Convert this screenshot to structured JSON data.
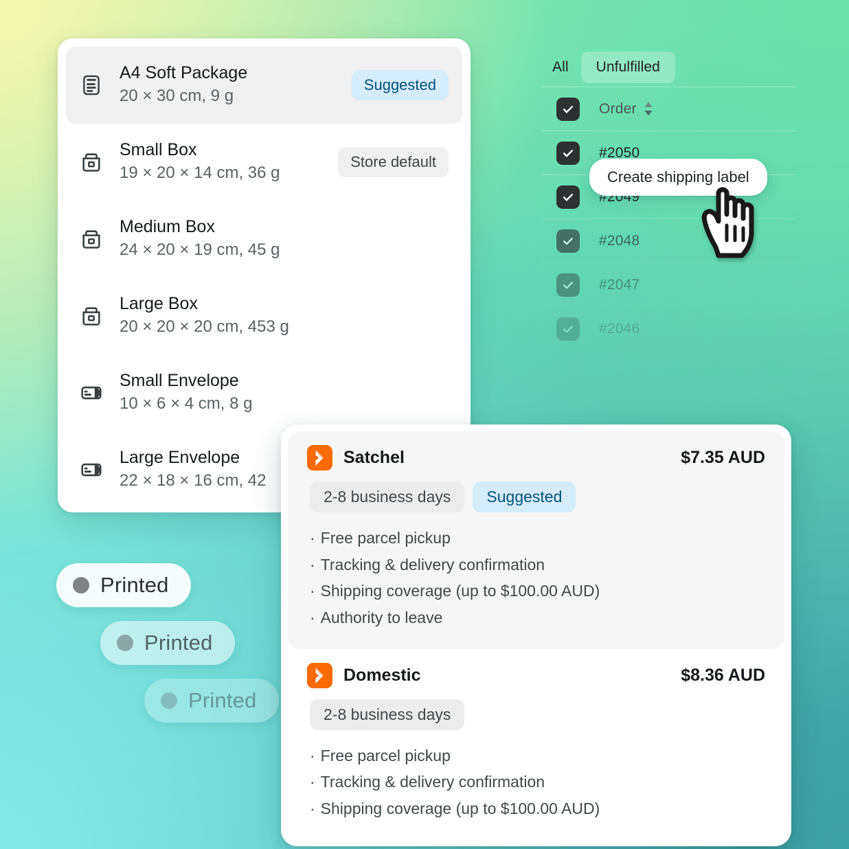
{
  "background": {
    "colors": [
      "#f4f6ae",
      "#6ae2ab",
      "#84e8e8",
      "#3f9fa6"
    ]
  },
  "package_picker": {
    "items": [
      {
        "icon": "soft-package-icon",
        "title": "A4 Soft Package",
        "dimensions": "20 × 30 cm, 9 g",
        "badge": "Suggested",
        "badge_kind": "suggested",
        "selected": true
      },
      {
        "icon": "box-icon",
        "title": "Small Box",
        "dimensions": "19 × 20 × 14 cm, 36 g",
        "badge": "Store default",
        "badge_kind": "storedef",
        "selected": false
      },
      {
        "icon": "box-icon",
        "title": "Medium Box",
        "dimensions": "24 × 20 × 19 cm, 45 g",
        "badge": "",
        "badge_kind": "",
        "selected": false
      },
      {
        "icon": "box-icon",
        "title": "Large Box",
        "dimensions": "20 × 20 × 20 cm, 453 g",
        "badge": "",
        "badge_kind": "",
        "selected": false
      },
      {
        "icon": "envelope-icon",
        "title": "Small Envelope",
        "dimensions": "10 × 6 × 4 cm, 8 g",
        "badge": "",
        "badge_kind": "",
        "selected": false
      },
      {
        "icon": "envelope-icon",
        "title": "Large Envelope",
        "dimensions": "22 × 18 × 16 cm, 42",
        "badge": "",
        "badge_kind": "",
        "selected": false
      }
    ]
  },
  "orders_panel": {
    "tabs": [
      {
        "label": "All",
        "active": false
      },
      {
        "label": "Unfulfilled",
        "active": true
      }
    ],
    "column_header": "Order",
    "sort_icon": "sort-arrows-icon",
    "rows": [
      {
        "label": "#2050",
        "checked": true
      },
      {
        "label": "#2049",
        "checked": true
      },
      {
        "label": "#2048",
        "checked": true
      },
      {
        "label": "#2047",
        "checked": true
      },
      {
        "label": "#2046",
        "checked": true
      }
    ]
  },
  "create_label_button": {
    "label": "Create shipping label"
  },
  "cursor": {
    "icon": "pointing-hand-cursor"
  },
  "printed_pills": [
    {
      "label": "Printed"
    },
    {
      "label": "Printed"
    },
    {
      "label": "Printed"
    }
  ],
  "shipping_rates": {
    "rates": [
      {
        "carrier_logo": "australia-post-logo",
        "name": "Satchel",
        "price": "$7.35 AUD",
        "tags": [
          {
            "text": "2-8 business days",
            "kind": "grey"
          },
          {
            "text": "Suggested",
            "kind": "blue"
          }
        ],
        "features": [
          "Free parcel pickup",
          "Tracking & delivery confirmation",
          "Shipping coverage (up to $100.00 AUD)",
          "Authority to leave"
        ],
        "highlight": true
      },
      {
        "carrier_logo": "australia-post-logo",
        "name": "Domestic",
        "price": "$8.36 AUD",
        "tags": [
          {
            "text": "2-8 business days",
            "kind": "grey"
          }
        ],
        "features": [
          "Free parcel pickup",
          "Tracking & delivery confirmation",
          "Shipping coverage (up to $100.00 AUD)"
        ],
        "highlight": false
      }
    ]
  },
  "colors": {
    "accent_blue_bg": "#d5ecfa",
    "accent_blue_text": "#00527c",
    "carrier_orange": "#f96a05",
    "checkbox_dark": "#2e3132"
  }
}
